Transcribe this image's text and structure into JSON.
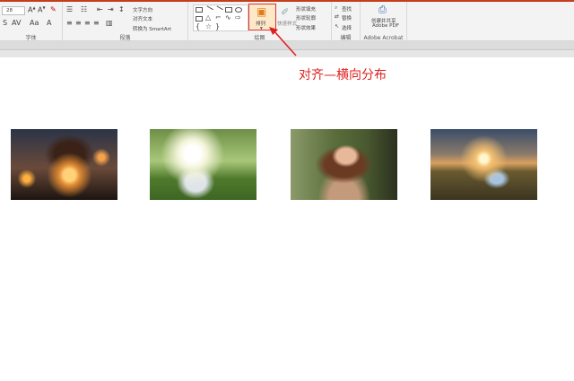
{
  "ribbon": {
    "font_size_value": "28",
    "font_group_label": "字体",
    "paragraph": {
      "text_direction": "文字方向",
      "align_text": "对齐文本",
      "convert_smartart": "转换为 SmartArt",
      "group_label": "段落"
    },
    "drawing": {
      "arrange_label": "排列",
      "quick_styles_label": "快速样式",
      "shape_fill": "形状填充",
      "shape_outline": "形状轮廓",
      "shape_effects": "形状效果",
      "group_label": "绘图"
    },
    "editing": {
      "find": "查找",
      "replace": "替换",
      "select": "选择",
      "group_label": "编辑"
    },
    "acrobat": {
      "create_share_line1": "创建并共享",
      "create_share_line2": "Adobe PDF",
      "group_label": "Adobe Acrobat"
    }
  },
  "annotation": {
    "text": "对齐—横向分布",
    "color": "#e02020"
  },
  "slide": {
    "photos": [
      {
        "name": "girl-with-lights",
        "colors": [
          "#2a1a14",
          "#c2632a",
          "#f5b04a"
        ]
      },
      {
        "name": "girl-in-sunlit-field",
        "colors": [
          "#7fa85a",
          "#f2f4e6",
          "#3f6b2a"
        ]
      },
      {
        "name": "woman-portrait",
        "colors": [
          "#5a7040",
          "#b7825e",
          "#3a2418"
        ]
      },
      {
        "name": "woman-at-sunset",
        "colors": [
          "#2c3a52",
          "#f0b060",
          "#5a5030"
        ]
      }
    ]
  }
}
